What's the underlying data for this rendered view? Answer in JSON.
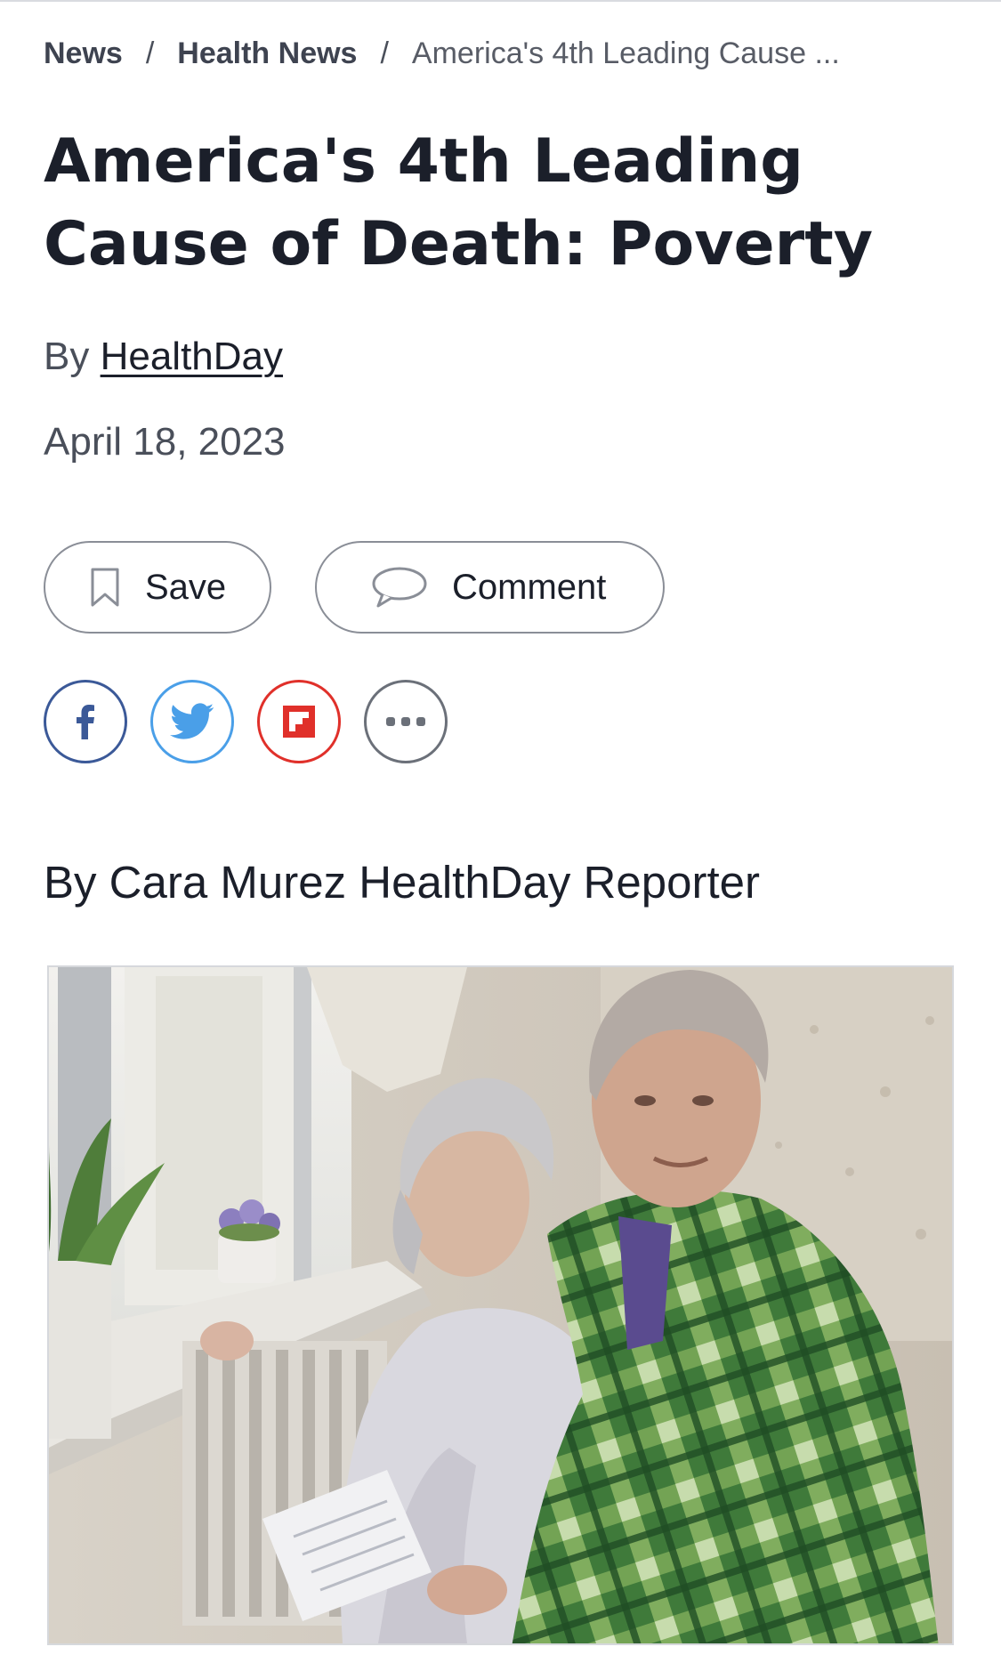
{
  "breadcrumb": {
    "items": [
      "News",
      "Health News"
    ],
    "separator": "/",
    "current": "America's 4th Leading Cause ..."
  },
  "article": {
    "title": "America's 4th Leading Cause of Death: Poverty",
    "byline_prefix": "By",
    "author": "HealthDay",
    "date": "April 18, 2023",
    "reporter_line": "By Cara Murez HealthDay Reporter"
  },
  "actions": {
    "save_label": "Save",
    "comment_label": "Comment"
  },
  "share": [
    {
      "name": "facebook",
      "icon": "facebook-icon",
      "color": "#3b5998"
    },
    {
      "name": "twitter",
      "icon": "twitter-icon",
      "color": "#4a9fe8"
    },
    {
      "name": "flipboard",
      "icon": "flipboard-icon",
      "color": "#e0302a"
    },
    {
      "name": "more",
      "icon": "more-dots-icon",
      "color": "#6b7079"
    }
  ],
  "image": {
    "subject": "elderly couple wrapped in a green plaid blanket next to a radiator"
  }
}
